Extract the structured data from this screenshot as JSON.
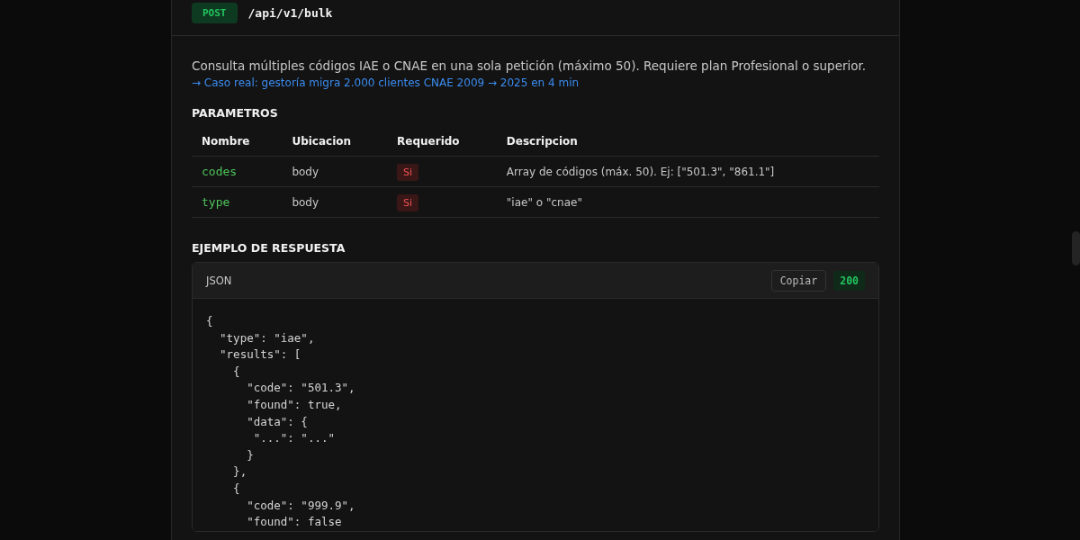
{
  "endpoint": {
    "method": "POST",
    "path": "/api/v1/bulk"
  },
  "description": "Consulta múltiples códigos IAE o CNAE en una sola petición (máximo 50). Requiere plan Profesional o superior.",
  "case_link": "→ Caso real: gestoría migra 2.000 clientes CNAE 2009 → 2025 en 4 min",
  "parameters": {
    "title": "PARAMETROS",
    "columns": [
      "Nombre",
      "Ubicacion",
      "Requerido",
      "Descripcion"
    ],
    "rows": [
      {
        "name": "codes",
        "location": "body",
        "required": "Si",
        "description": "Array de códigos (máx. 50). Ej: [\"501.3\", \"861.1\"]"
      },
      {
        "name": "type",
        "location": "body",
        "required": "Si",
        "description": "\"iae\" o \"cnae\""
      }
    ]
  },
  "response": {
    "title": "EJEMPLO DE RESPUESTA",
    "language": "JSON",
    "copy_button": "Copiar",
    "status": "200",
    "code_lines": [
      "{",
      "  \"type\": \"iae\",",
      "  \"results\": [",
      "    {",
      "      \"code\": \"501.3\",",
      "      \"found\": true,",
      "      \"data\": {",
      "       \"...\": \"...\"",
      "      }",
      "    },",
      "    {",
      "      \"code\": \"999.9\",",
      "      \"found\": false"
    ]
  }
}
